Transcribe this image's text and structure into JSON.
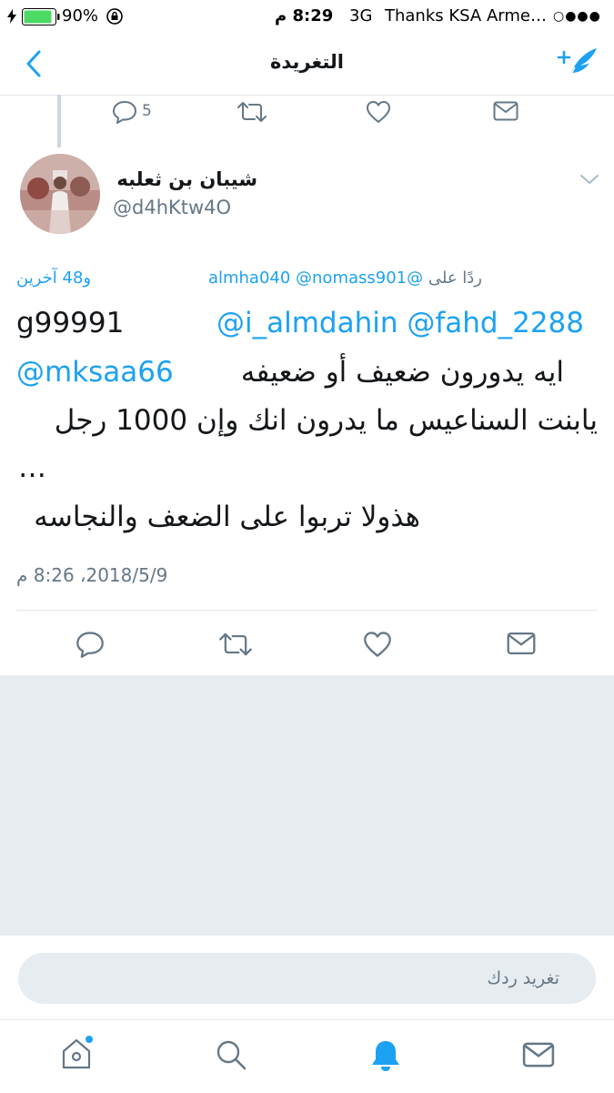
{
  "status_bar": {
    "battery_percent": "90%",
    "time": "8:29 م",
    "network": "3G",
    "carrier": "Thanks KSA Arme…",
    "signal_dots": "○●●●"
  },
  "nav": {
    "title": "التغريدة"
  },
  "previous_tweet": {
    "reply_count": "5"
  },
  "tweet": {
    "display_name": "شيبان بن ثعلبه",
    "handle": "@d4hKtw4O",
    "reply_prefix": "ردًا على",
    "reply_mentions": "@almha040 @nomass901",
    "reply_others": "و48 آخرين",
    "line1_mentions": "@i_almdahin @fahd_2288",
    "line1_text": "g99991",
    "line2_mention": "@mksaa66",
    "line2_text": "ايه يدورون ضعيف أو ضعيفه",
    "line3_text": "يابنت السناعيس ما يدرون انك وإن 1000 رجل",
    "line4_text": "…",
    "line5_text": "هذولا تربوا على الضعف والنجاسه",
    "timestamp": "2018/5/9، 8:26 م"
  },
  "composer": {
    "placeholder": "تغريد ردك"
  },
  "tabs": [
    "home",
    "explore",
    "notifications",
    "messages"
  ],
  "colors": {
    "accent": "#1da1f2",
    "muted": "#657786",
    "background_grey": "#e6ecf0"
  }
}
